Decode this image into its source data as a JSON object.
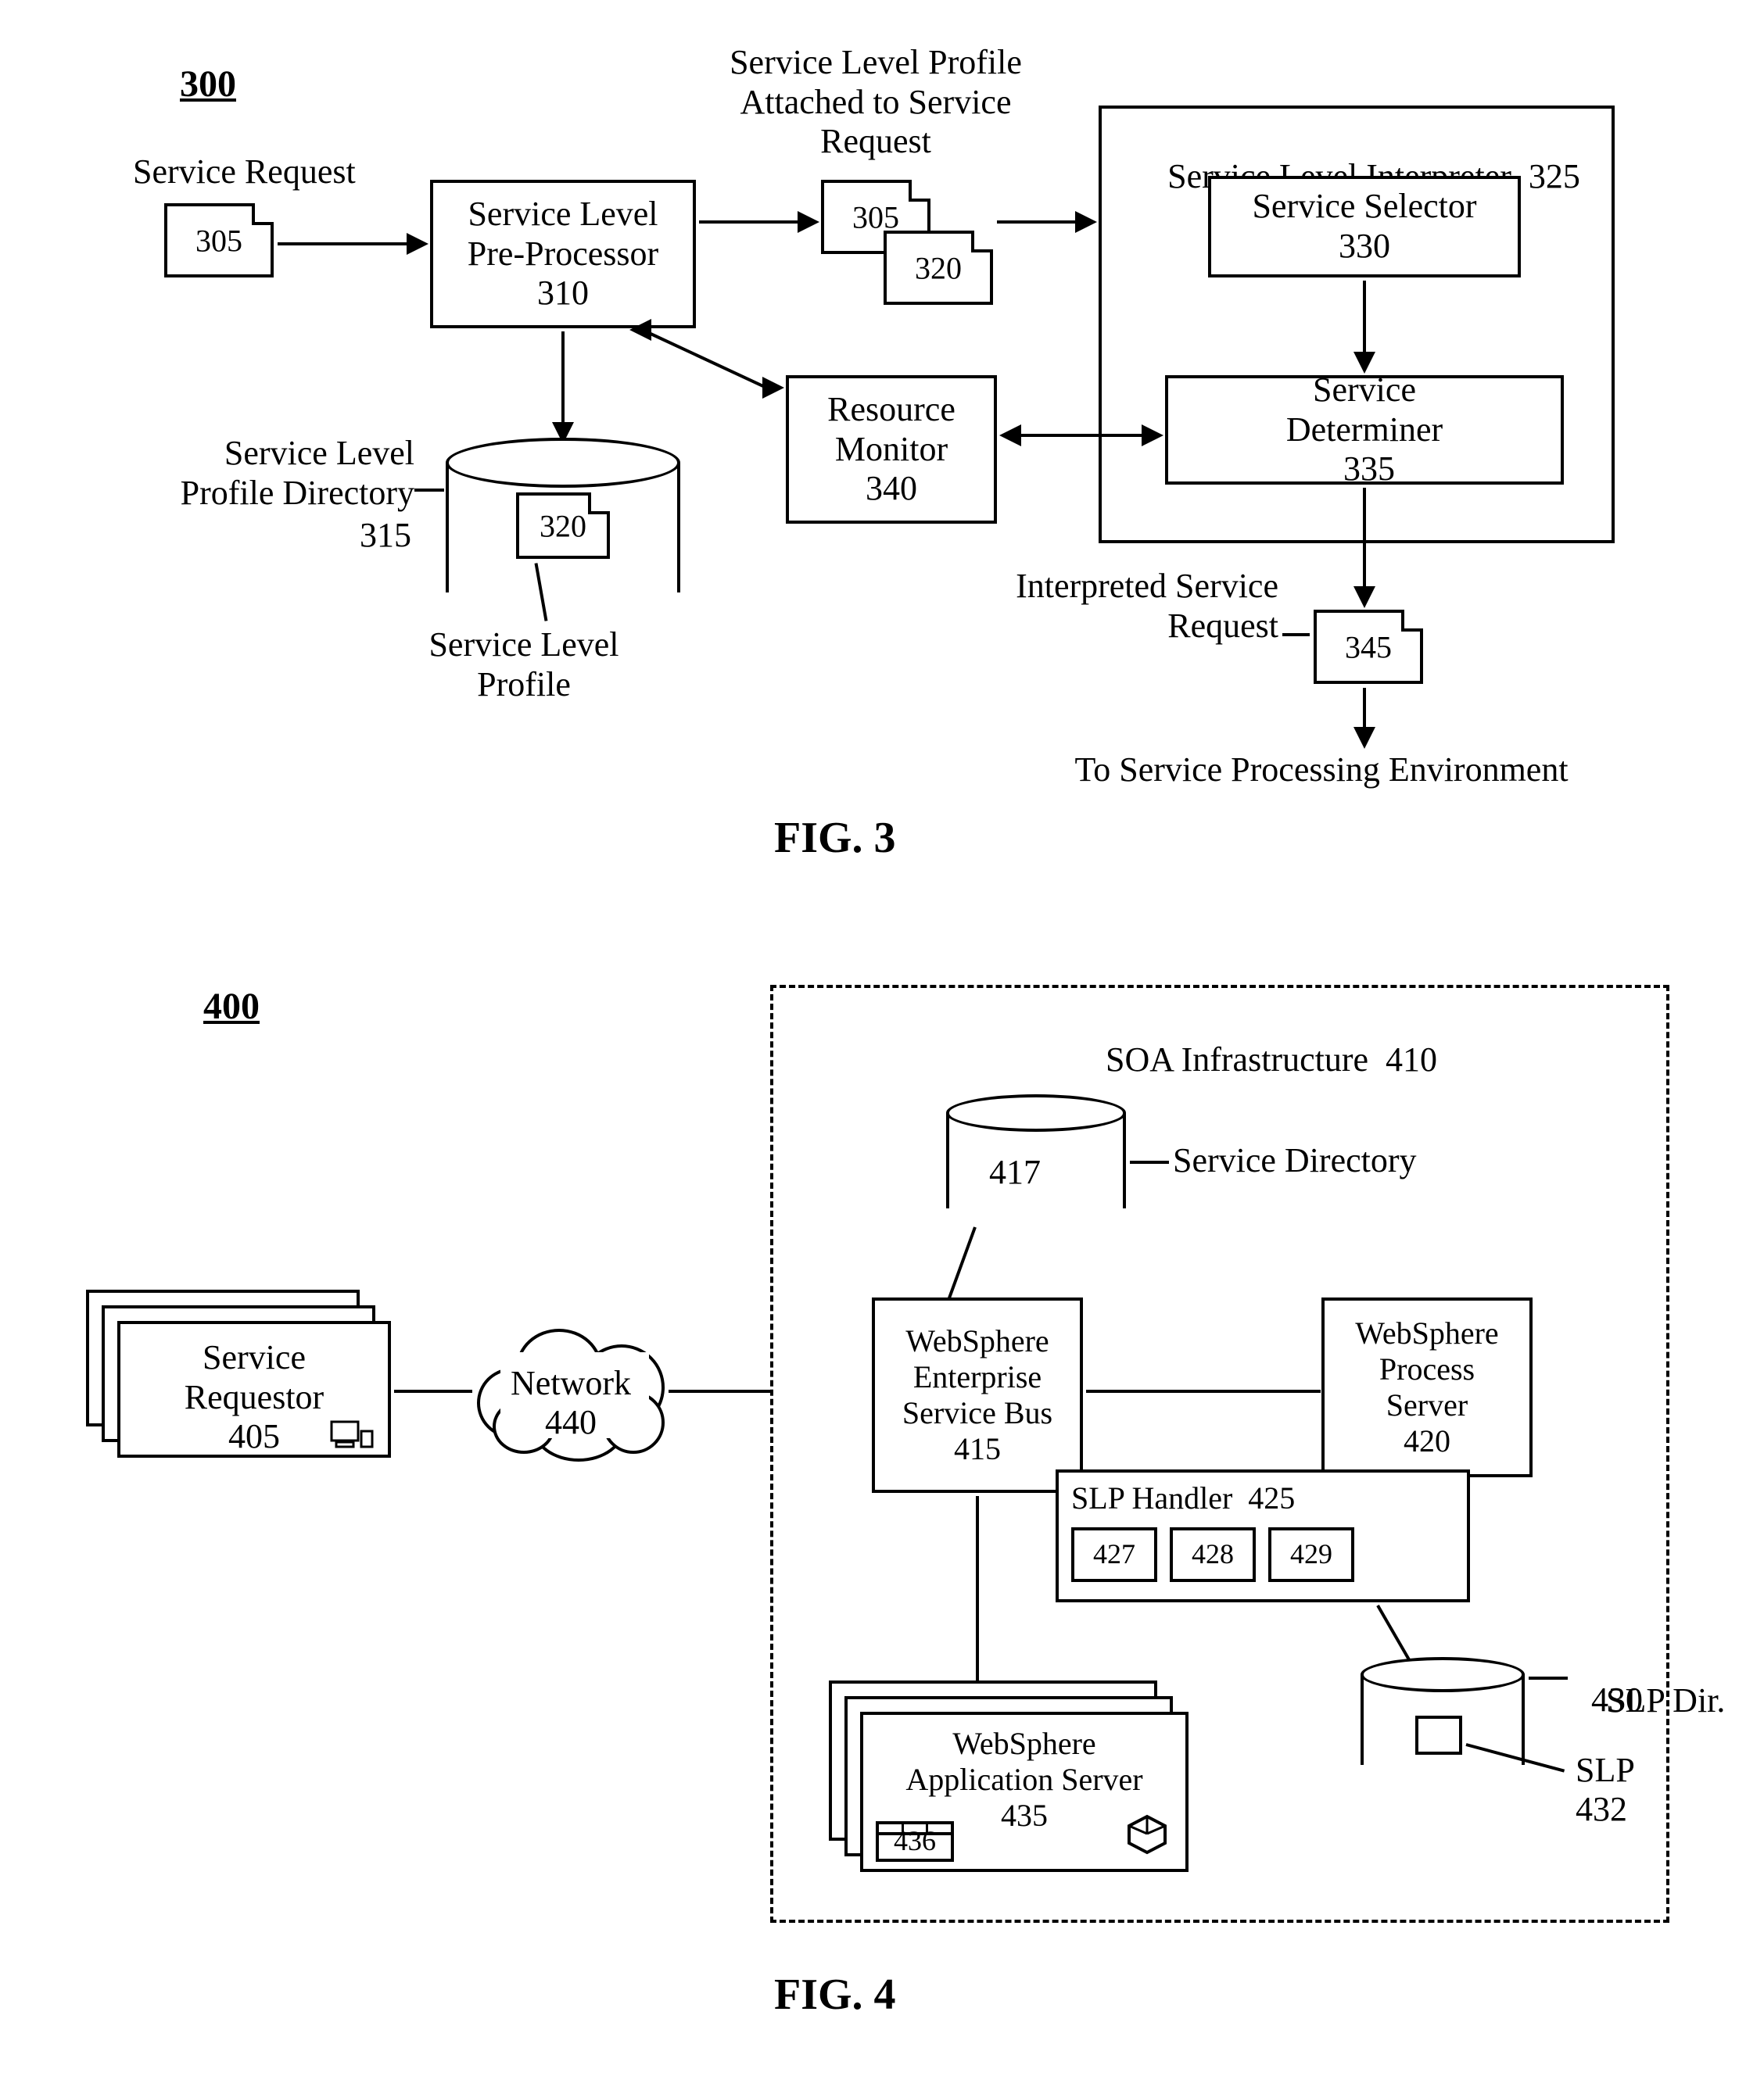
{
  "fig3": {
    "ref": "300",
    "caption": "FIG. 3",
    "service_request_label": "Service Request",
    "doc305": "305",
    "preproc": {
      "title": "Service Level\nPre-Processor",
      "num": "310"
    },
    "attached_label": "Service Level Profile\nAttached to Service\nRequest",
    "doc305b": "305",
    "doc320b": "320",
    "slp_dir_label": "Service Level\nProfile Directory",
    "slp_dir_num": "315",
    "slp_doc": "320",
    "slp_label": "Service Level\nProfile",
    "resmon": {
      "title": "Resource\nMonitor",
      "num": "340"
    },
    "interp": {
      "title": "Service Level Interpreter",
      "num": "325"
    },
    "selector": {
      "title": "Service Selector",
      "num": "330"
    },
    "determiner": {
      "title": "Service\nDeterminer",
      "num": "335"
    },
    "interp_req_label": "Interpreted Service\nRequest",
    "interp_req_doc": "345",
    "out_label": "To Service Processing Environment"
  },
  "fig4": {
    "ref": "400",
    "caption": "FIG. 4",
    "requestor": {
      "title": "Service\nRequestor",
      "num": "405"
    },
    "network": {
      "title": "Network",
      "num": "440"
    },
    "soa": {
      "title": "SOA Infrastructure",
      "num": "410"
    },
    "svcdir": {
      "num": "417",
      "label": "Service Directory"
    },
    "esb": {
      "title": "WebSphere\nEnterprise\nService Bus",
      "num": "415"
    },
    "procsrv": {
      "title": "WebSphere\nProcess\nServer",
      "num": "420"
    },
    "slphandler": {
      "title": "SLP Handler",
      "num": "425",
      "b1": "427",
      "b2": "428",
      "b3": "429"
    },
    "appsrv": {
      "title": "WebSphere\nApplication Server",
      "num": "435",
      "minibox": "436"
    },
    "slpdir": {
      "label": "SLP Dir.",
      "num": "430"
    },
    "slp": {
      "label": "SLP",
      "num": "432"
    }
  }
}
